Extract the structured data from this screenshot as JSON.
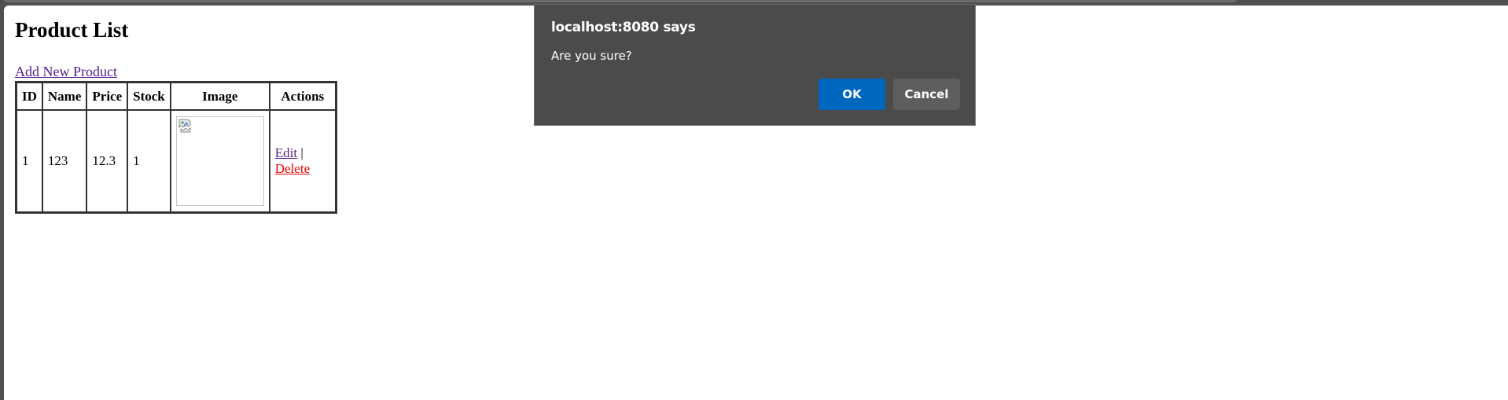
{
  "page": {
    "title": "Product List",
    "add_link": "Add New Product"
  },
  "table": {
    "headers": [
      "ID",
      "Name",
      "Price",
      "Stock",
      "Image",
      "Actions"
    ],
    "rows": [
      {
        "id": "1",
        "name": "123",
        "price": "12.3",
        "stock": "1",
        "image": "broken-image-icon",
        "edit": "Edit",
        "separator": "|",
        "delete": "Delete"
      }
    ]
  },
  "dialog": {
    "title": "localhost:8080 says",
    "message": "Are you sure?",
    "ok_label": "OK",
    "cancel_label": "Cancel"
  },
  "colors": {
    "visited_link": "#551a8b",
    "delete_link": "#ee0000",
    "dialog_bg": "#4b4b4b",
    "ok_button": "#0067c0",
    "cancel_button": "#5e5e5e"
  }
}
